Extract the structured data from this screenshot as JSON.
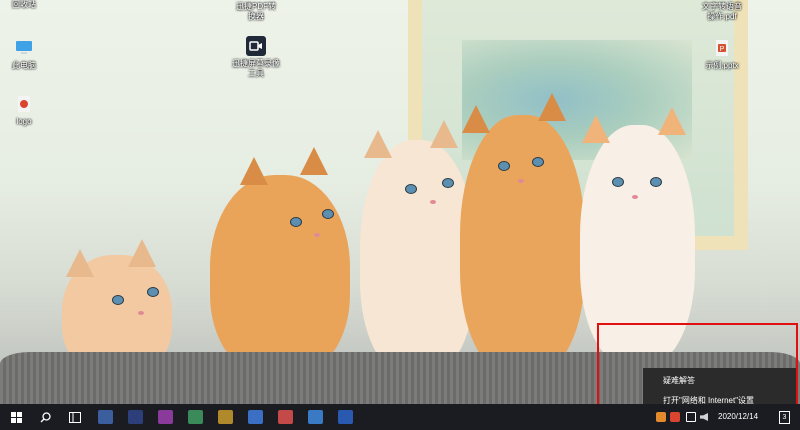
{
  "desktop": {
    "icons": [
      {
        "label": "回收站",
        "icon": "recycle-bin-icon"
      },
      {
        "label": "此电脑",
        "icon": "computer-icon"
      },
      {
        "label": "logo",
        "icon": "image-file-icon"
      },
      {
        "label": "迅捷PDF转\n换器",
        "icon": "pdf-converter-icon"
      },
      {
        "label": "迅捷屏幕录像\n工具",
        "icon": "screen-recorder-icon"
      },
      {
        "label": "文字转语音\n操作.pdf",
        "icon": "pdf-file-icon"
      },
      {
        "label": "示例.pptx",
        "icon": "pptx-file-icon"
      }
    ]
  },
  "context_menu": {
    "items": [
      {
        "label": "疑难解答"
      },
      {
        "label": "打开\"网络和 Internet\"设置"
      }
    ]
  },
  "taskbar": {
    "start_icon": "windows-start-icon",
    "search_icon": "search-icon",
    "taskview_icon": "task-view-icon",
    "app_colors": [
      "#3b5f9e",
      "#2d3f7a",
      "#8a3a9a",
      "#3b8a5a",
      "#b08a2a",
      "#3a6fc4",
      "#c44a4a",
      "#3a7ac4",
      "#2a5ab0"
    ],
    "tray": {
      "date": "2020/12/14",
      "notification_count": "3"
    }
  },
  "colors": {
    "highlight": "#e01010",
    "menu_bg": "#2b2b2b",
    "taskbar_bg": "#1b1c22"
  }
}
